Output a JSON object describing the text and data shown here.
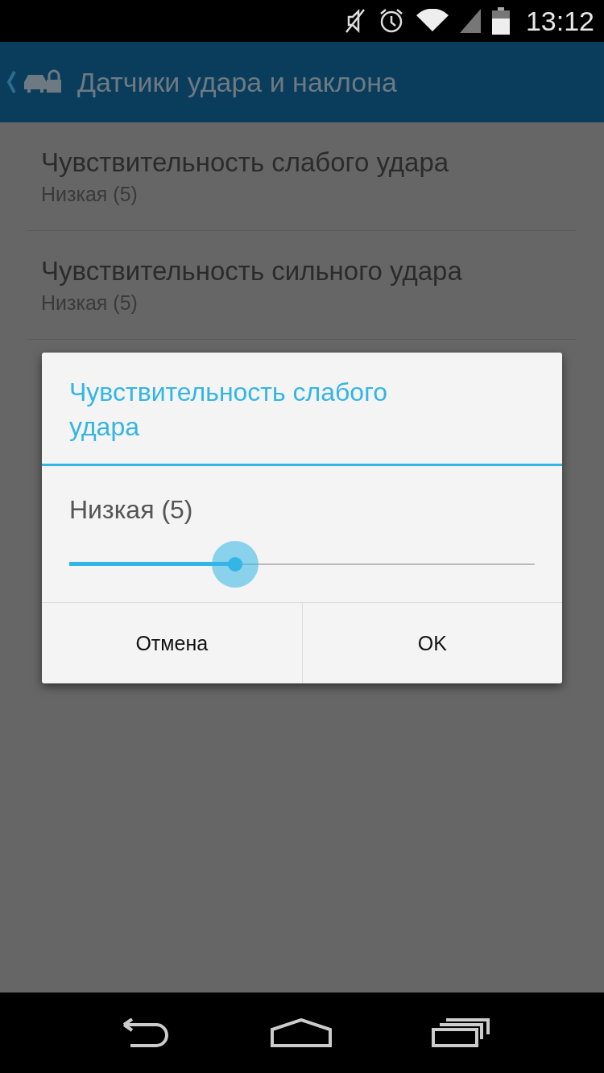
{
  "status_bar": {
    "time": "13:12"
  },
  "action_bar": {
    "title": "Датчики удара и наклона"
  },
  "settings": [
    {
      "title": "Чувствительность слабого удара",
      "summary": "Низкая (5)"
    },
    {
      "title": "Чувствительность сильного удара",
      "summary": "Низкая (5)"
    }
  ],
  "dialog": {
    "title": "Чувствительность слабого удара",
    "value": "Низкая (5)",
    "slider": {
      "level": 0.356
    },
    "buttons": [
      "Отмена",
      "OK"
    ]
  }
}
